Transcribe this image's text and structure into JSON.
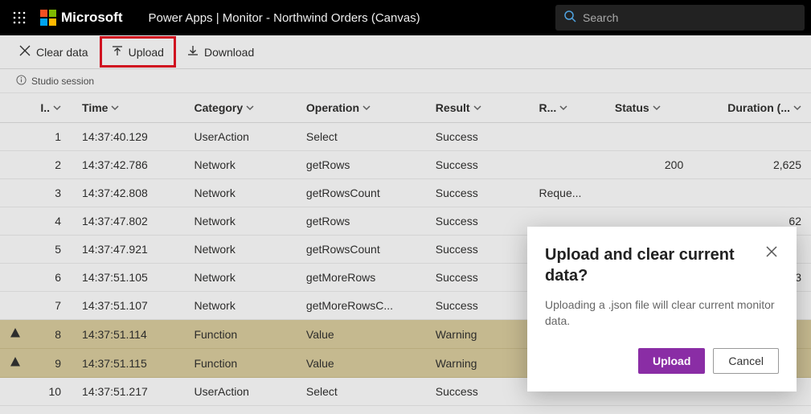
{
  "header": {
    "brand": "Microsoft",
    "title": "Power Apps  |  Monitor - Northwind Orders (Canvas)",
    "search_placeholder": "Search"
  },
  "toolbar": {
    "clear": "Clear data",
    "upload": "Upload",
    "download": "Download"
  },
  "status": {
    "session": "Studio session"
  },
  "table": {
    "headers": {
      "id": "I..",
      "time": "Time",
      "category": "Category",
      "operation": "Operation",
      "result": "Result",
      "r": "R...",
      "status": "Status",
      "duration": "Duration (..."
    },
    "rows": [
      {
        "warn": false,
        "id": "1",
        "time": "14:37:40.129",
        "category": "UserAction",
        "operation": "Select",
        "result": "Success",
        "r": "",
        "status": "",
        "duration": ""
      },
      {
        "warn": false,
        "id": "2",
        "time": "14:37:42.786",
        "category": "Network",
        "operation": "getRows",
        "result": "Success",
        "r": "",
        "status": "200",
        "duration": "2,625"
      },
      {
        "warn": false,
        "id": "3",
        "time": "14:37:42.808",
        "category": "Network",
        "operation": "getRowsCount",
        "result": "Success",
        "r": "Reque...",
        "status": "",
        "duration": ""
      },
      {
        "warn": false,
        "id": "4",
        "time": "14:37:47.802",
        "category": "Network",
        "operation": "getRows",
        "result": "Success",
        "r": "",
        "status": "",
        "duration": "62"
      },
      {
        "warn": false,
        "id": "5",
        "time": "14:37:47.921",
        "category": "Network",
        "operation": "getRowsCount",
        "result": "Success",
        "r": "",
        "status": "",
        "duration": ""
      },
      {
        "warn": false,
        "id": "6",
        "time": "14:37:51.105",
        "category": "Network",
        "operation": "getMoreRows",
        "result": "Success",
        "r": "",
        "status": "",
        "duration": "93"
      },
      {
        "warn": false,
        "id": "7",
        "time": "14:37:51.107",
        "category": "Network",
        "operation": "getMoreRowsC...",
        "result": "Success",
        "r": "",
        "status": "",
        "duration": ""
      },
      {
        "warn": true,
        "id": "8",
        "time": "14:37:51.114",
        "category": "Function",
        "operation": "Value",
        "result": "Warning",
        "r": "",
        "status": "",
        "duration": ""
      },
      {
        "warn": true,
        "id": "9",
        "time": "14:37:51.115",
        "category": "Function",
        "operation": "Value",
        "result": "Warning",
        "r": "",
        "status": "",
        "duration": ""
      },
      {
        "warn": false,
        "id": "10",
        "time": "14:37:51.217",
        "category": "UserAction",
        "operation": "Select",
        "result": "Success",
        "r": "",
        "status": "",
        "duration": ""
      }
    ]
  },
  "dialog": {
    "title": "Upload and clear current data?",
    "body": "Uploading a .json file will clear current monitor data.",
    "upload": "Upload",
    "cancel": "Cancel"
  }
}
